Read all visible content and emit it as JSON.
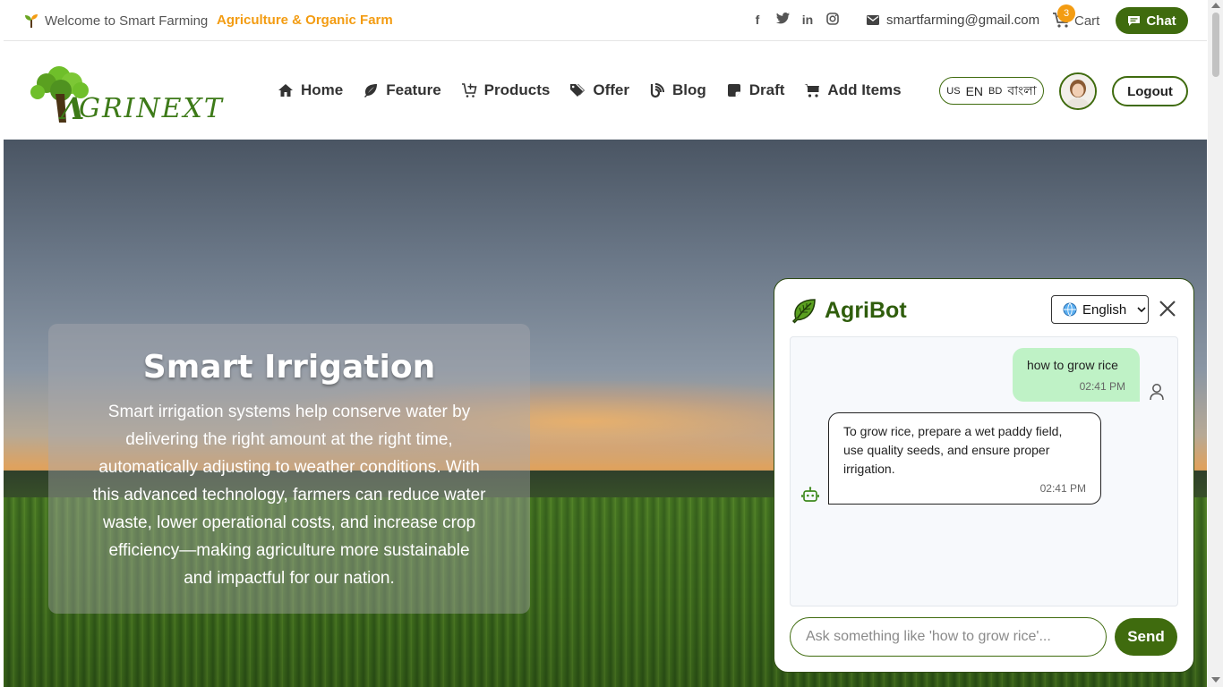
{
  "topbar": {
    "welcome_text": "Welcome to Smart Farming",
    "tagline": "Agriculture & Organic Farm",
    "social_icons": [
      "facebook-icon",
      "twitter-icon",
      "linkedin-icon",
      "instagram-icon"
    ],
    "email": "smartfarming@gmail.com",
    "cart_count": "3",
    "cart_label": "Cart",
    "chat_label": "Chat"
  },
  "navbar": {
    "logo_text": "AGRINEXT",
    "items": [
      {
        "label": "Home",
        "icon": "home-icon"
      },
      {
        "label": "Feature",
        "icon": "leaf-icon"
      },
      {
        "label": "Products",
        "icon": "cart-plus-icon"
      },
      {
        "label": "Offer",
        "icon": "tags-icon"
      },
      {
        "label": "Blog",
        "icon": "blog-icon"
      },
      {
        "label": "Draft",
        "icon": "note-icon"
      },
      {
        "label": "Add Items",
        "icon": "shopping-cart-icon"
      }
    ],
    "lang_en_code": "US",
    "lang_en": "EN",
    "lang_bn_code": "BD",
    "lang_bn": "বাংলা",
    "logout_label": "Logout"
  },
  "hero": {
    "title": "Smart Irrigation",
    "body": "Smart irrigation systems help conserve water by delivering the right amount at the right time, automatically adjusting to weather conditions. With this advanced technology, farmers can reduce water waste, lower operational costs, and increase crop efficiency—making agriculture more sustainable and impactful for our nation."
  },
  "chatbot": {
    "title": "AgriBot",
    "language_selected": "English",
    "messages": [
      {
        "sender": "user",
        "text": "how to grow rice",
        "time": "02:41 PM"
      },
      {
        "sender": "bot",
        "text": "To grow rice, prepare a wet paddy field, use quality seeds, and ensure proper irrigation.",
        "time": "02:41 PM"
      }
    ],
    "input_placeholder": "Ask something like 'how to grow rice'...",
    "send_label": "Send"
  },
  "colors": {
    "brand_green": "#3f6b0e",
    "accent_orange": "#f39c12",
    "user_bubble": "#bff2c6"
  }
}
